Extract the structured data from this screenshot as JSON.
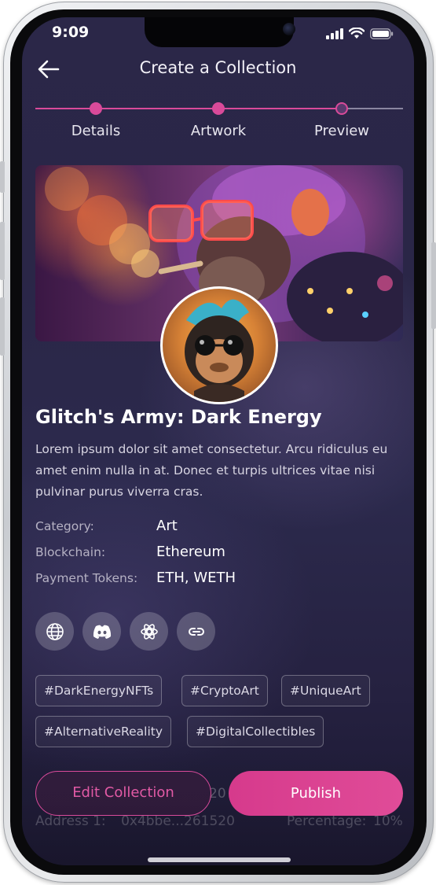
{
  "status_bar": {
    "time": "9:09"
  },
  "header": {
    "title": "Create a Collection"
  },
  "stepper": {
    "steps": [
      "Details",
      "Artwork",
      "Preview"
    ],
    "active_color": "#d94a9a",
    "inactive_color": "#8a86a0"
  },
  "collection": {
    "title": "Glitch's Army: Dark Energy",
    "description": "Lorem ipsum dolor sit amet consectetur. Arcu ridiculus eu amet enim nulla in at. Donec et turpis ultrices vitae nisi pulvinar purus viverra cras.",
    "details": [
      {
        "label": "Category:",
        "value": "Art"
      },
      {
        "label": "Blockchain:",
        "value": "Ethereum"
      },
      {
        "label": "Payment Tokens:",
        "value": "ETH, WETH"
      }
    ],
    "social_icons": [
      "globe-icon",
      "discord-icon",
      "opensea-icon",
      "link-icon"
    ],
    "tags": [
      "#DarkEnergyNFTs",
      "#CryptoArt",
      "#UniqueArt",
      "#AlternativeReality",
      "#DigitalCollectibles"
    ]
  },
  "royalty_preview": {
    "address_label": "Address 1:",
    "address_value": "0x4bbe...261520",
    "percentage_label": "Percentage:",
    "percentage_value": "10%",
    "partial_text": "20"
  },
  "actions": {
    "edit_label": "Edit Collection",
    "publish_label": "Publish"
  },
  "colors": {
    "accent": "#d94a9a",
    "background": "#2b2748"
  }
}
